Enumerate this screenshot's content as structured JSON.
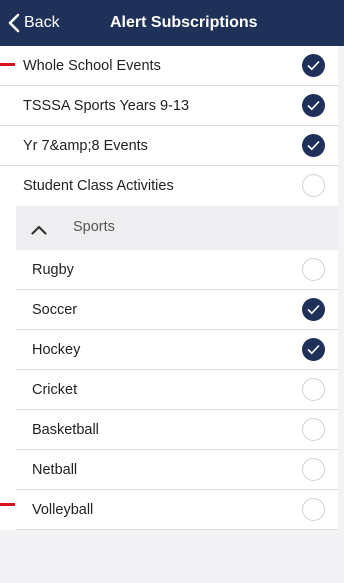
{
  "navbar": {
    "back_label": "Back",
    "title": "Alert Subscriptions"
  },
  "subscriptions": [
    {
      "label": "Whole School Events",
      "checked": true
    },
    {
      "label": "TSSSA Sports Years 9-13",
      "checked": true
    },
    {
      "label": "Yr 7&amp;8 Events",
      "checked": true
    },
    {
      "label": "Student Class Activities",
      "checked": false
    }
  ],
  "sports_section": {
    "label": "Sports",
    "expanded": true,
    "items": [
      {
        "label": "Rugby",
        "checked": false
      },
      {
        "label": "Soccer",
        "checked": true
      },
      {
        "label": "Hockey",
        "checked": true
      },
      {
        "label": "Cricket",
        "checked": false
      },
      {
        "label": "Basketball",
        "checked": false
      },
      {
        "label": "Netball",
        "checked": false
      },
      {
        "label": "Volleyball",
        "checked": false
      }
    ]
  },
  "colors": {
    "accent": "#1f3158",
    "annotation": "#d4151c"
  }
}
